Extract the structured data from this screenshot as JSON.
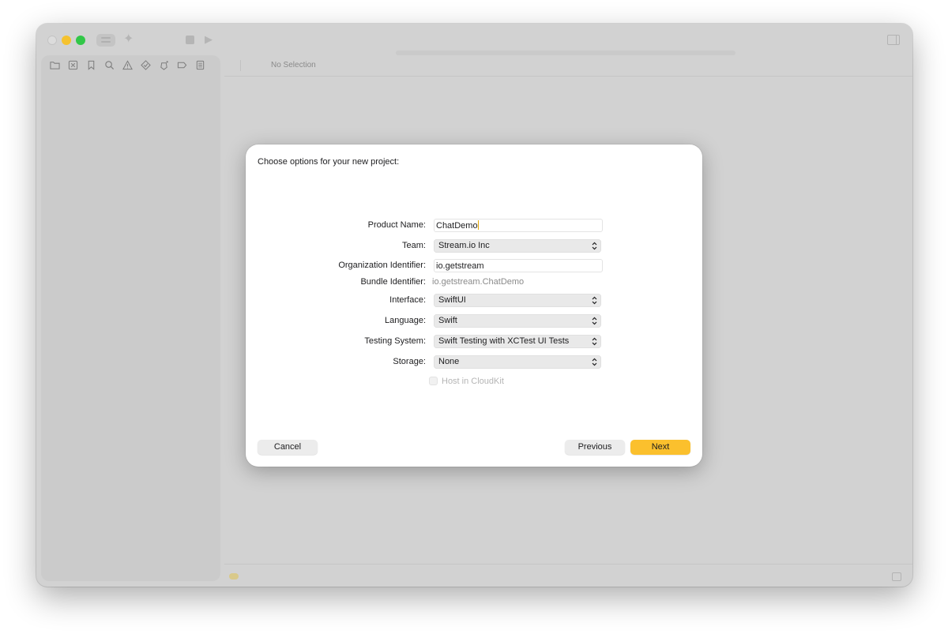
{
  "colors": {
    "accent": "#fbc02d",
    "window_bg": "#d2d2d2",
    "traffic_close": "#dcdcdc",
    "traffic_minimize": "#f5c22f",
    "traffic_maximize": "#32c748"
  },
  "toolbar": {
    "icons": [
      "sidebar-toggle-icon",
      "sparkle-icon",
      "stop-icon",
      "play-icon",
      "inspector-toggle-icon"
    ]
  },
  "navigator": {
    "icons": [
      "folder-icon",
      "source-control-icon",
      "bookmark-icon",
      "search-icon",
      "warning-icon",
      "test-icon",
      "debug-icon",
      "breakpoint-icon",
      "report-icon"
    ]
  },
  "editor": {
    "breadcrumb": "No Selection"
  },
  "dialog": {
    "title": "Choose options for your new project:",
    "fields": {
      "product_name": {
        "label": "Product Name:",
        "value": "ChatDemo"
      },
      "team": {
        "label": "Team:",
        "value": "Stream.io Inc"
      },
      "organization_identifier": {
        "label": "Organization Identifier:",
        "value": "io.getstream"
      },
      "bundle_identifier": {
        "label": "Bundle Identifier:",
        "value": "io.getstream.ChatDemo"
      },
      "interface": {
        "label": "Interface:",
        "value": "SwiftUI"
      },
      "language": {
        "label": "Language:",
        "value": "Swift"
      },
      "testing_system": {
        "label": "Testing System:",
        "value": "Swift Testing with XCTest UI Tests"
      },
      "storage": {
        "label": "Storage:",
        "value": "None"
      }
    },
    "host_in_cloudkit": {
      "label": "Host in CloudKit",
      "checked": false,
      "enabled": false
    },
    "buttons": {
      "cancel": "Cancel",
      "previous": "Previous",
      "next": "Next"
    }
  }
}
